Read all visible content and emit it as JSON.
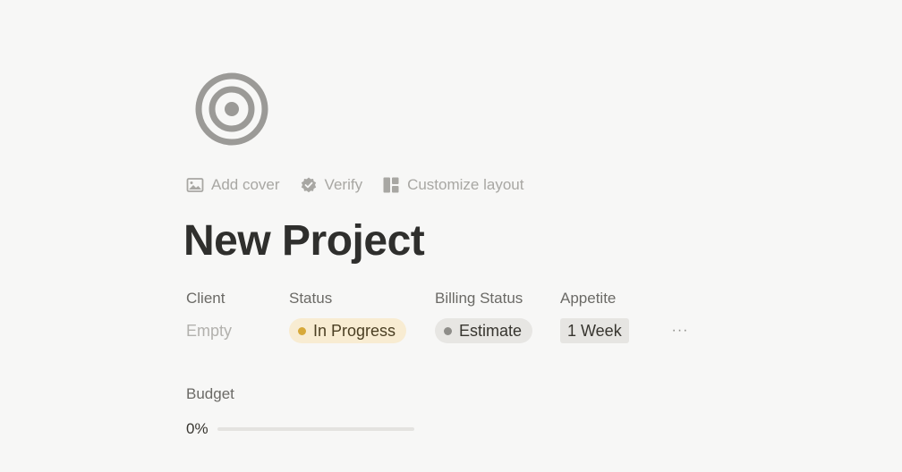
{
  "page": {
    "icon": "target-icon",
    "title": "New Project"
  },
  "toolbar": {
    "add_cover": {
      "label": "Add cover",
      "icon": "image-icon"
    },
    "verify": {
      "label": "Verify",
      "icon": "verified-badge-icon"
    },
    "customize_layout": {
      "label": "Customize layout",
      "icon": "layout-icon"
    }
  },
  "properties": [
    {
      "label": "Client",
      "value": "Empty",
      "type": "empty"
    },
    {
      "label": "Status",
      "value": "In Progress",
      "type": "status",
      "color": "#d7a93a",
      "background": "#f8ecd2"
    },
    {
      "label": "Billing Status",
      "value": "Estimate",
      "type": "status",
      "color": "#8e8d89",
      "background": "#e7e6e3"
    },
    {
      "label": "Appetite",
      "value": "1 Week",
      "type": "select"
    }
  ],
  "more_properties_label": "···",
  "budget": {
    "label": "Budget",
    "value_text": "0%",
    "progress": 0
  }
}
